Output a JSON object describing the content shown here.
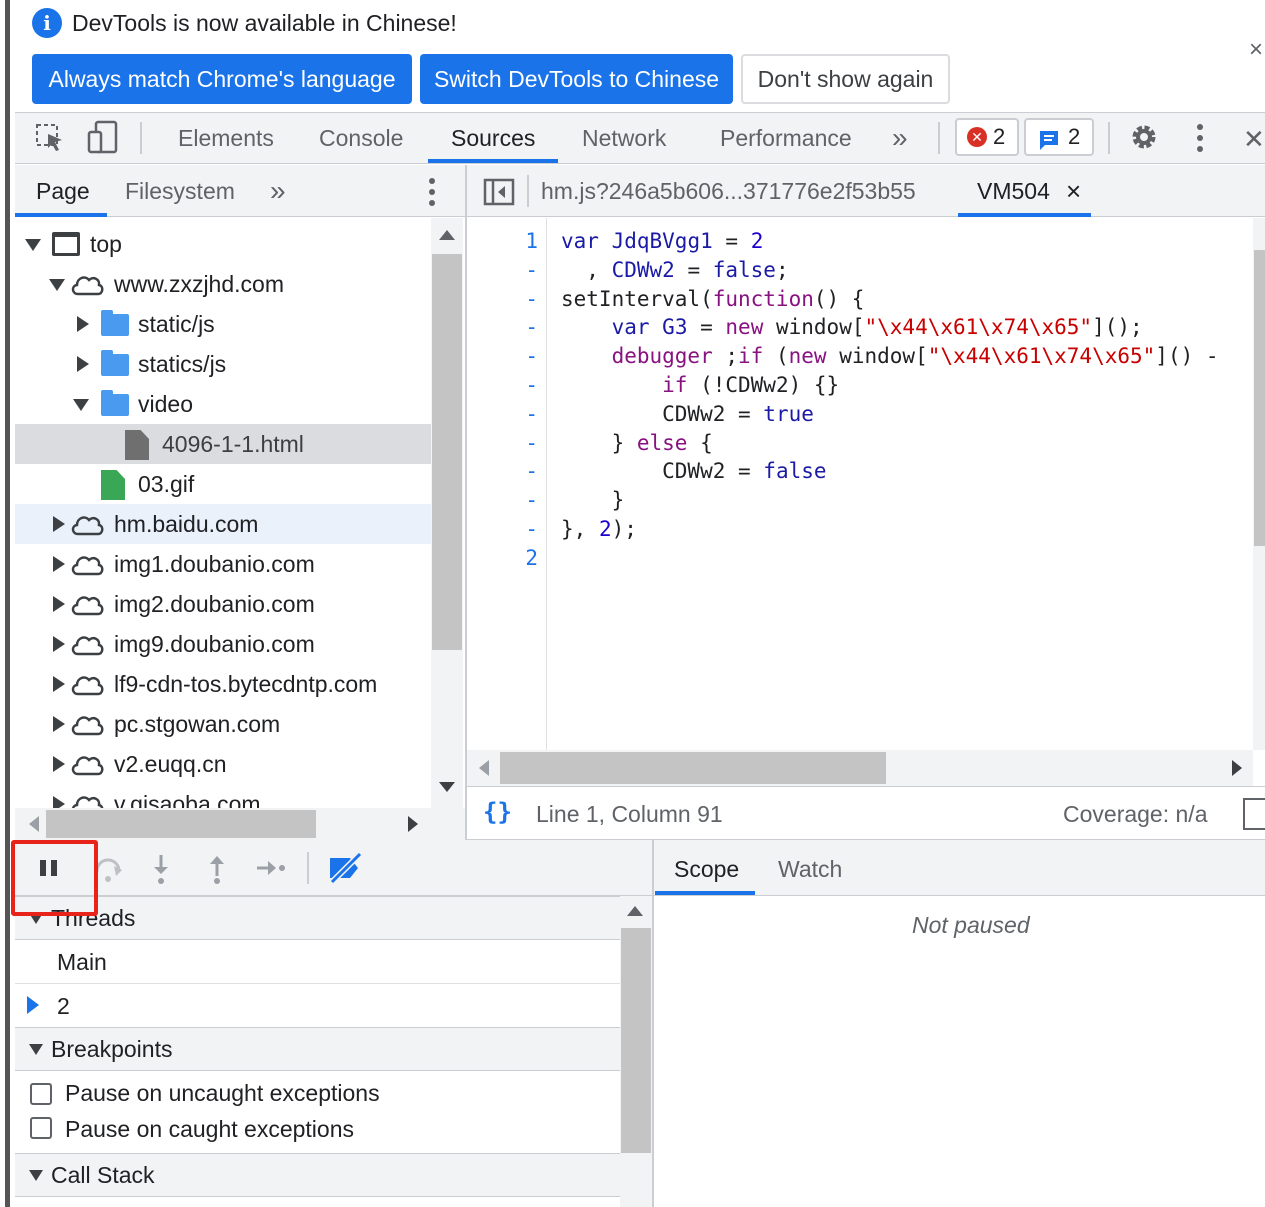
{
  "infobar": {
    "message": "DevTools is now available in Chinese!",
    "btn_match": "Always match Chrome's language",
    "btn_switch": "Switch DevTools to Chinese",
    "btn_dont_show": "Don't show again",
    "close": "×"
  },
  "toolbar": {
    "tabs": [
      "Elements",
      "Console",
      "Sources",
      "Network",
      "Performance"
    ],
    "more": "»",
    "errors_count": "2",
    "messages_count": "2",
    "close": "✕"
  },
  "navigator": {
    "tabs": [
      "Page",
      "Filesystem"
    ],
    "more": "»",
    "tree": [
      {
        "label": "top"
      },
      {
        "label": "www.zxzjhd.com"
      },
      {
        "label": "static/js"
      },
      {
        "label": "statics/js"
      },
      {
        "label": "video"
      },
      {
        "label": "4096-1-1.html"
      },
      {
        "label": "03.gif"
      },
      {
        "label": "hm.baidu.com"
      },
      {
        "label": "img1.doubanio.com"
      },
      {
        "label": "img2.doubanio.com"
      },
      {
        "label": "img9.doubanio.com"
      },
      {
        "label": "lf9-cdn-tos.bytecdntp.com"
      },
      {
        "label": "pc.stgowan.com"
      },
      {
        "label": "v2.euqq.cn"
      },
      {
        "label": "v.qisaoba.com"
      }
    ]
  },
  "editor": {
    "tabs": [
      "hm.js?246a5b606...371776e2f53b55",
      "VM504"
    ],
    "tab_close": "×",
    "line_numbers": [
      "1",
      "-",
      "-",
      "-",
      "-",
      "-",
      "-",
      "-",
      "-",
      "-",
      "-",
      "2"
    ],
    "status": {
      "braces": "{}",
      "position": "Line 1, Column 91",
      "coverage": "Coverage: n/a"
    }
  },
  "debugger": {
    "sections": {
      "threads": "Threads",
      "breakpoints": "Breakpoints",
      "call_stack": "Call Stack"
    },
    "threads": [
      "Main",
      "2"
    ],
    "breakpoint_options": [
      "Pause on uncaught exceptions",
      "Pause on caught exceptions"
    ],
    "scope_tabs": [
      "Scope",
      "Watch"
    ],
    "not_paused": "Not paused"
  },
  "colors": {
    "accent": "#1a73e8",
    "highlight_box": "#e8231a"
  }
}
